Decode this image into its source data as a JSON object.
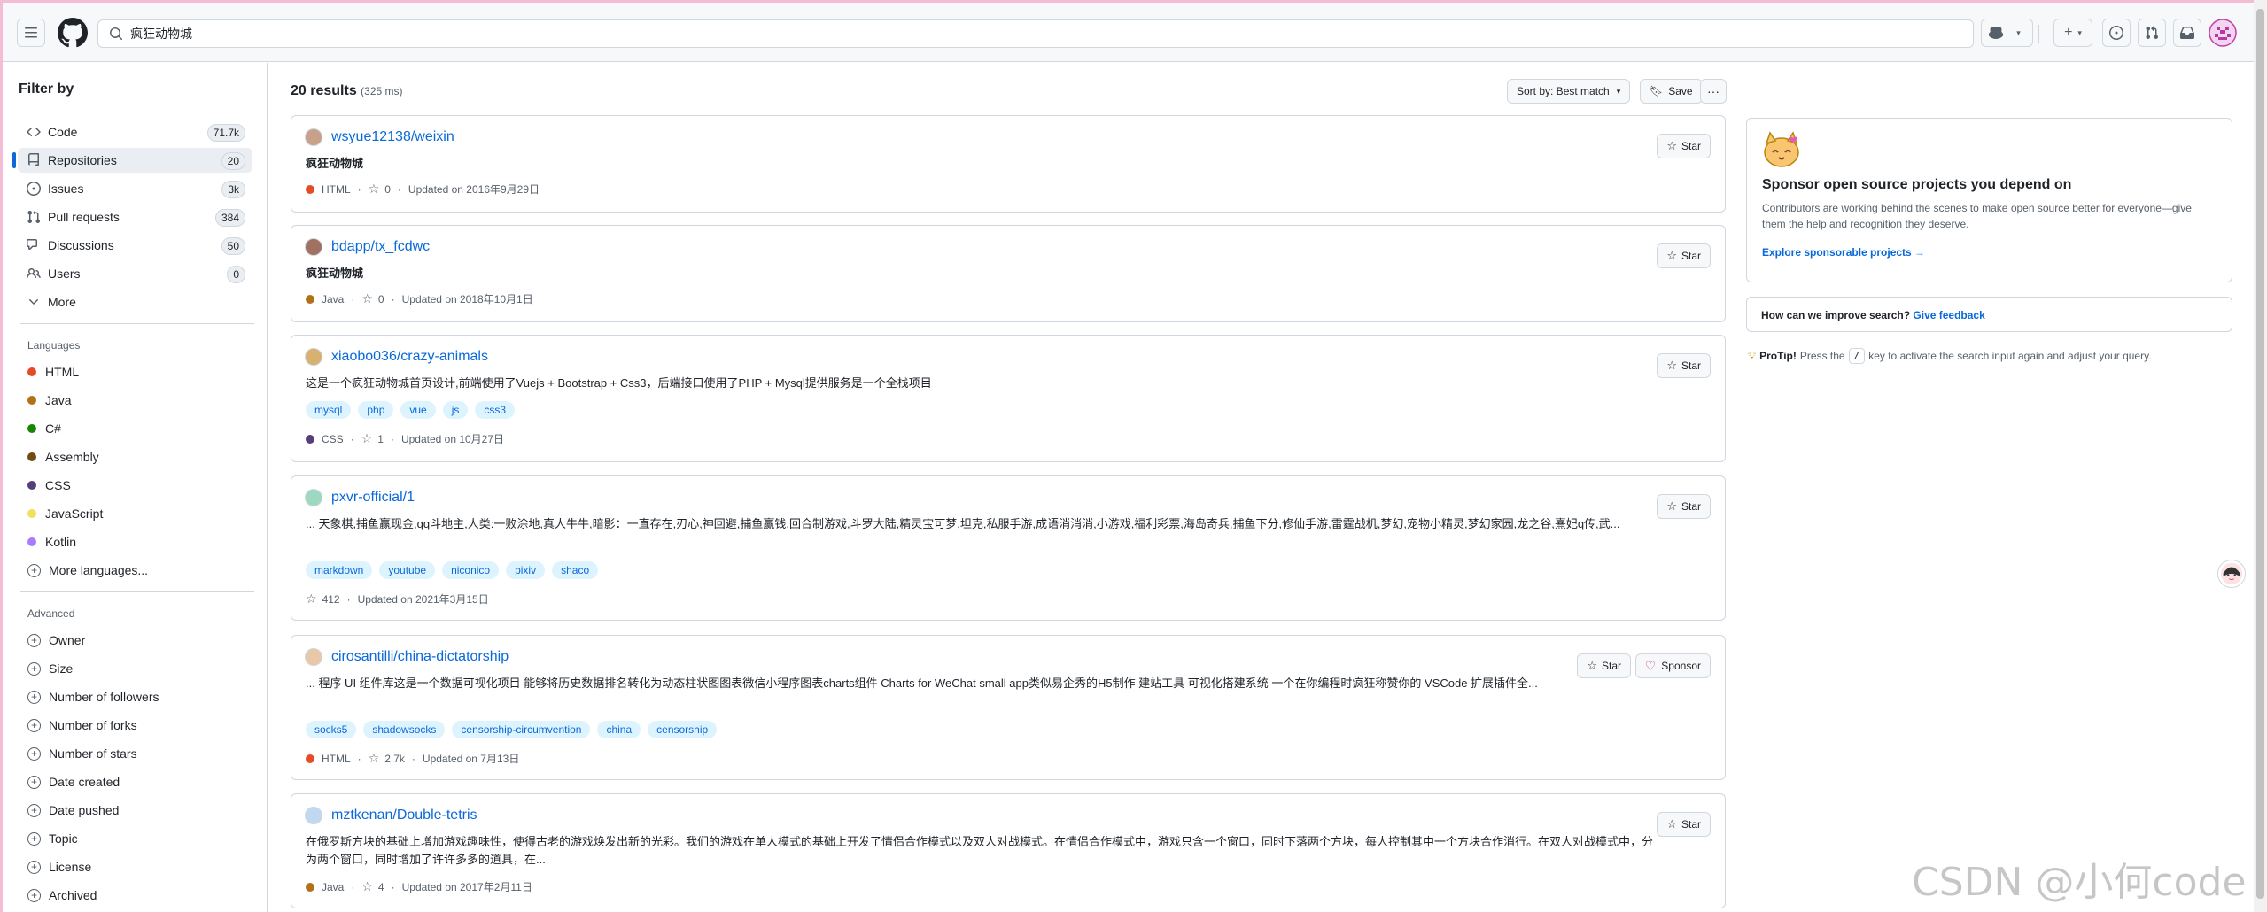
{
  "header": {
    "search_query": "疯狂动物城"
  },
  "sidebar": {
    "title": "Filter by",
    "types": [
      {
        "label": "Code",
        "count": "71.7k",
        "icon": "code-icon"
      },
      {
        "label": "Repositories",
        "count": "20",
        "icon": "repo-icon",
        "active": true
      },
      {
        "label": "Issues",
        "count": "3k",
        "icon": "issue-icon"
      },
      {
        "label": "Pull requests",
        "count": "384",
        "icon": "pull-request-icon"
      },
      {
        "label": "Discussions",
        "count": "50",
        "icon": "discussion-icon"
      },
      {
        "label": "Users",
        "count": "0",
        "icon": "people-icon"
      },
      {
        "label": "More",
        "icon": "chevron-down-icon"
      }
    ],
    "languages_heading": "Languages",
    "languages": [
      {
        "name": "HTML",
        "color": "#e34c26"
      },
      {
        "name": "Java",
        "color": "#b07219"
      },
      {
        "name": "C#",
        "color": "#178600"
      },
      {
        "name": "Assembly",
        "color": "#6e4c13"
      },
      {
        "name": "CSS",
        "color": "#563d7c"
      },
      {
        "name": "JavaScript",
        "color": "#f1e05a"
      },
      {
        "name": "Kotlin",
        "color": "#a97bff"
      }
    ],
    "more_languages": "More languages...",
    "advanced_heading": "Advanced",
    "advanced": [
      "Owner",
      "Size",
      "Number of followers",
      "Number of forks",
      "Number of stars",
      "Date created",
      "Date pushed",
      "Topic",
      "License",
      "Archived"
    ]
  },
  "results": {
    "count_label": "20 results",
    "time_label": "(325 ms)",
    "sort_label": "Sort by: Best match",
    "save_label": "Save",
    "more_label": "···",
    "star_label": "Star",
    "sponsor_label": "Sponsor",
    "items": [
      {
        "name": "wsyue12138/weixin",
        "desc": "疯狂动物城",
        "language": "HTML",
        "lang_color": "#e34c26",
        "stars": "0",
        "updated": "Updated on 2016年9月29日",
        "tags": []
      },
      {
        "name": "bdapp/tx_fcdwc",
        "desc": "疯狂动物城",
        "language": "Java",
        "lang_color": "#b07219",
        "stars": "0",
        "updated": "Updated on 2018年10月1日",
        "tags": []
      },
      {
        "name": "xiaobo036/crazy-animals",
        "desc": "这是一个疯狂动物城首页设计,前端使用了Vuejs + Bootstrap + Css3，后端接口使用了PHP + Mysql提供服务是一个全栈项目",
        "language": "CSS",
        "lang_color": "#563d7c",
        "stars": "1",
        "updated": "Updated on 10月27日",
        "tags": [
          "mysql",
          "php",
          "vue",
          "js",
          "css3"
        ]
      },
      {
        "name": "pxvr-official/1",
        "desc": "... 天象棋,捕鱼赢现金,qq斗地主,人类:一败涂地,真人牛牛,暗影：一直存在,刃心,神回避,捕鱼赢钱,回合制游戏,斗罗大陆,精灵宝可梦,坦克,私服手游,成语消消消,小游戏,福利彩票,海岛奇兵,捕鱼下分,修仙手游,雷霆战机,梦幻,宠物小精灵,梦幻家园,龙之谷,熹妃q传,武...",
        "language": "",
        "lang_color": "",
        "stars": "412",
        "updated": "Updated on 2021年3月15日",
        "tags": [
          "markdown",
          "youtube",
          "niconico",
          "pixiv",
          "shaco"
        ]
      },
      {
        "name": "cirosantilli/china-dictatorship",
        "desc": "... 程序 UI 组件库这是一个数据可视化项目 能够将历史数据排名转化为动态柱状图图表微信小程序图表charts组件 Charts for WeChat small app类似易企秀的H5制作 建站工具 可视化搭建系统 一个在你编程时疯狂称赞你的 VSCode 扩展插件全...",
        "language": "HTML",
        "lang_color": "#e34c26",
        "stars": "2.7k",
        "updated": "Updated on 7月13日",
        "tags": [
          "socks5",
          "shadowsocks",
          "censorship-circumvention",
          "china",
          "censorship"
        ],
        "sponsor": true
      },
      {
        "name": "mztkenan/Double-tetris",
        "desc": "在俄罗斯方块的基础上增加游戏趣味性，使得古老的游戏焕发出新的光彩。我们的游戏在单人模式的基础上开发了情侣合作模式以及双人对战模式。在情侣合作模式中，游戏只含一个窗口，同时下落两个方块，每人控制其中一个方块合作消行。在双人对战模式中，分为两个窗口，同时增加了许许多多的道具，在...",
        "language": "Java",
        "lang_color": "#b07219",
        "stars": "4",
        "updated": "Updated on 2017年2月11日",
        "tags": []
      }
    ]
  },
  "sponsor_panel": {
    "title": "Sponsor open source projects you depend on",
    "body": "Contributors are working behind the scenes to make open source better for everyone—give them the help and recognition they deserve.",
    "link": "Explore sponsorable projects →"
  },
  "feedback": {
    "question": "How can we improve search?",
    "link": "Give feedback"
  },
  "protip": {
    "label": "ProTip!",
    "before": "Press the",
    "key": "/",
    "after": "key to activate the search input again and adjust your query."
  },
  "watermark": "CSDN @小何code"
}
